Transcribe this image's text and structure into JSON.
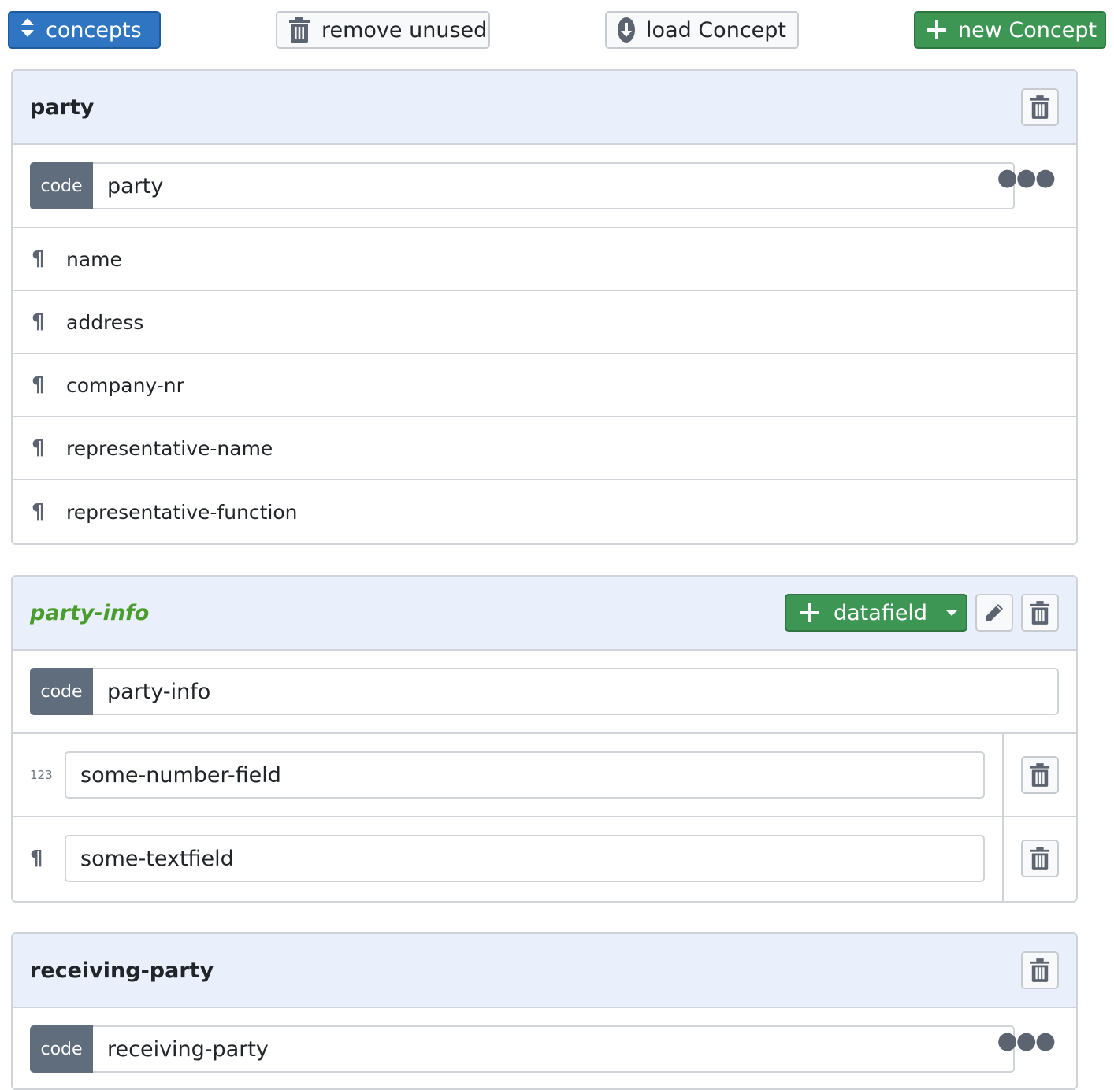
{
  "toolbar": {
    "concepts_label": "concepts",
    "remove_unused_label": "remove unused",
    "load_concept_label": "load Concept",
    "new_concept_label": "new Concept"
  },
  "concepts": [
    {
      "title": "party",
      "code_label": "code",
      "code_value": "party",
      "fields": [
        "name",
        "address",
        "company-nr",
        "representative-name",
        "representative-function"
      ]
    },
    {
      "title": "party-info",
      "code_label": "code",
      "code_value": "party-info",
      "datafield_label": "datafield",
      "fields": [
        {
          "type_glyph": "123",
          "value": "some-number-field"
        },
        {
          "type_glyph": "¶",
          "value": "some-textfield"
        }
      ]
    },
    {
      "title": "receiving-party",
      "code_label": "code",
      "code_value": "receiving-party"
    }
  ],
  "colors": {
    "primary": "#2f75c2",
    "success": "#3e9655",
    "header_bg": "#e9f0fc",
    "code_label_bg": "#5f6d7c",
    "highlight_title": "#4a9d2c"
  },
  "icons": {
    "concepts": "sort-icon",
    "remove_unused": "trash-icon",
    "load_concept": "download-circle-icon",
    "new_concept": "plus-icon",
    "field_text": "pilcrow-icon",
    "field_number": "number-icon",
    "edit": "pencil-icon",
    "more": "ellipsis-icon"
  }
}
